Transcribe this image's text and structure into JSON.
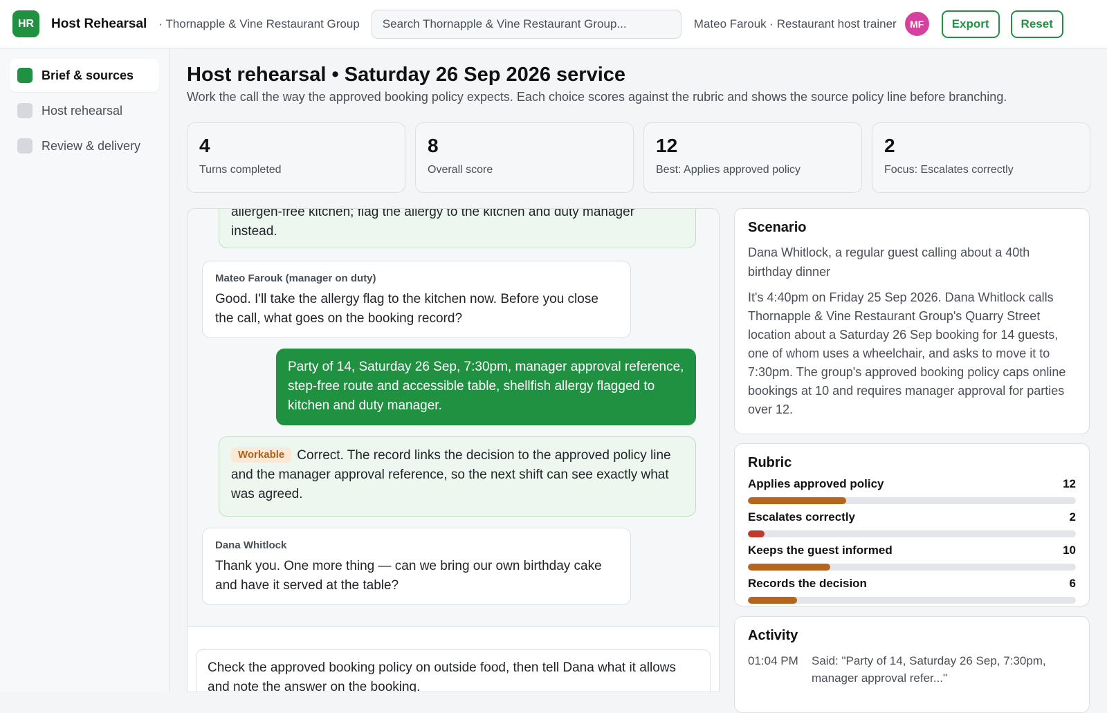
{
  "header": {
    "logo_initials": "HR",
    "app_name": "Host Rehearsal",
    "org_name": "· Thornapple & Vine Restaurant Group",
    "search_placeholder": "Search Thornapple & Vine Restaurant Group...",
    "user_label": "Mateo Farouk · Restaurant host trainer",
    "avatar_initials": "MF",
    "export_label": "Export",
    "reset_label": "Reset"
  },
  "sidebar": {
    "items": [
      {
        "label": "Brief & sources",
        "active": true
      },
      {
        "label": "Host rehearsal",
        "active": false
      },
      {
        "label": "Review & delivery",
        "active": false
      }
    ]
  },
  "page": {
    "title": "Host rehearsal • Saturday 26 Sep 2026 service",
    "subtitle": "Work the call the way the approved booking policy expects. Each choice scores against the rubric and shows the source policy line before branching."
  },
  "stats": [
    {
      "value": "4",
      "label": "Turns completed"
    },
    {
      "value": "8",
      "label": "Overall score"
    },
    {
      "value": "12",
      "label": "Best: Applies approved policy"
    },
    {
      "value": "2",
      "label": "Focus: Escalates correctly"
    }
  ],
  "chat": {
    "messages": [
      {
        "text": "allergen-free kitchen; flag the allergy to the kitchen and duty manager instead."
      },
      {
        "speaker": "Mateo Farouk (manager on duty)",
        "text": "Good. I'll take the allergy flag to the kitchen now. Before you close the call, what goes on the booking record?"
      },
      {
        "text": "Party of 14, Saturday 26 Sep, 7:30pm, manager approval reference, step-free route and accessible table, shellfish allergy flagged to kitchen and duty manager."
      },
      {
        "tag": "Workable",
        "text": "Correct. The record links the decision to the approved policy line and the manager approval reference, so the next shift can see exactly what was agreed."
      },
      {
        "speaker": "Dana Whitlock",
        "text": "Thank you. One more thing — can we bring our own birthday cake and have it served at the table?"
      }
    ],
    "prompt": "Check the approved booking policy on outside food, then tell Dana what it allows and note the answer on the booking."
  },
  "scenario": {
    "title": "Scenario",
    "lead": "Dana Whitlock, a regular guest calling about a 40th birthday dinner",
    "body": "It's 4:40pm on Friday 25 Sep 2026. Dana Whitlock calls Thornapple & Vine Restaurant Group's Quarry Street location about a Saturday 26 Sep booking for 14 guests, one of whom uses a wheelchair, and asks to move it to 7:30pm. The group's approved booking policy caps online bookings at 10 and requires manager approval for parties over 12."
  },
  "rubric": {
    "title": "Rubric",
    "max": 40,
    "items": [
      {
        "label": "Applies approved policy",
        "score": 12,
        "color": "#b5651d"
      },
      {
        "label": "Escalates correctly",
        "score": 2,
        "color": "#c0392b"
      },
      {
        "label": "Keeps the guest informed",
        "score": 10,
        "color": "#b5651d"
      },
      {
        "label": "Records the decision",
        "score": 6,
        "color": "#b5651d"
      }
    ]
  },
  "activity": {
    "title": "Activity",
    "items": [
      {
        "time": "01:04 PM",
        "text": "Said: \"Party of 14, Saturday 26 Sep, 7:30pm, manager approval refer...\""
      }
    ]
  },
  "colors": {
    "brand": "#1f9140",
    "avatar": "#d6409f",
    "bar_warn": "#b5651d",
    "bar_bad": "#c0392b"
  }
}
